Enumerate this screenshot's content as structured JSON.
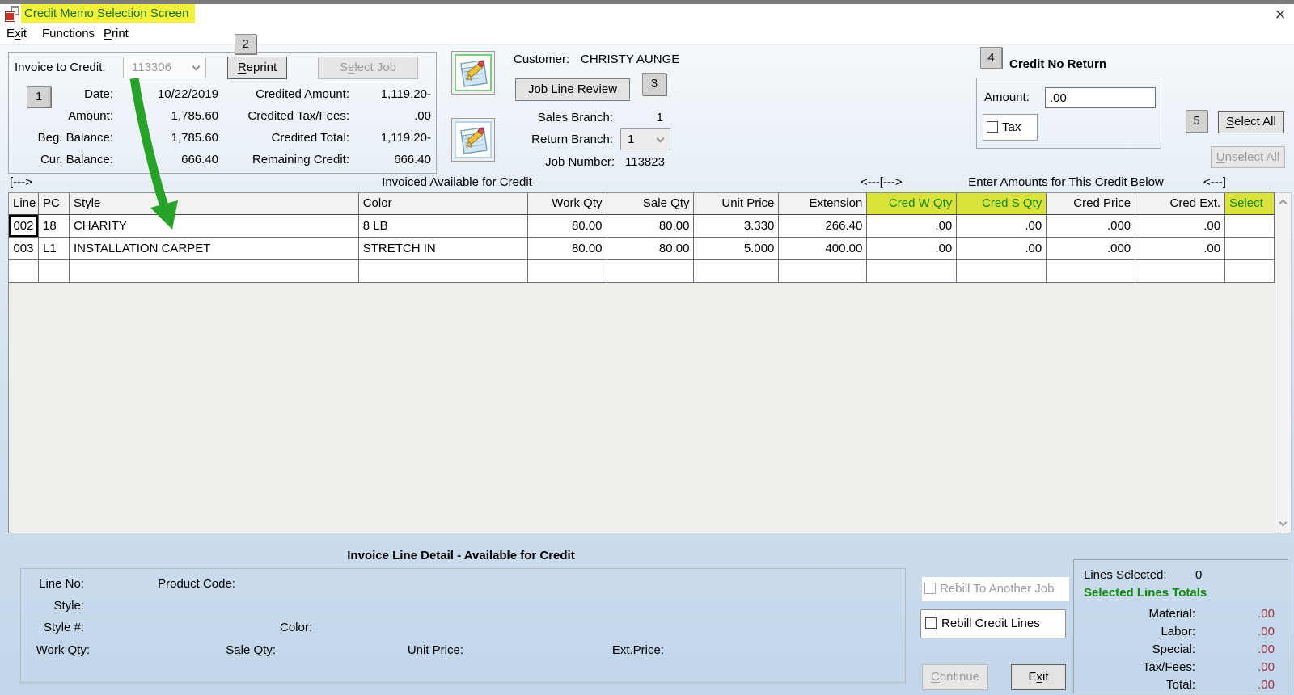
{
  "window": {
    "title": "Credit Memo Selection Screen",
    "close_glyph": "×"
  },
  "menu": {
    "exit": {
      "p": "E",
      "k": "x",
      "s": "it"
    },
    "functions": {
      "p": "Functions",
      "k": "",
      "s": ""
    },
    "print": {
      "p": "",
      "k": "P",
      "s": "rint"
    }
  },
  "badges": {
    "b1": "1",
    "b2": "2",
    "b3": "3",
    "b4": "4",
    "b5": "5"
  },
  "invoice_panel": {
    "invoice_to_credit_label": "Invoice to Credit:",
    "invoice_number": "113306",
    "reprint": {
      "p": "",
      "k": "R",
      "s": "eprint"
    },
    "select_job": {
      "p": "S",
      "k": "e",
      "s": "lect Job"
    },
    "left_fields": [
      {
        "label": "Date:",
        "value": "10/22/2019"
      },
      {
        "label": "Amount:",
        "value": "1,785.60"
      },
      {
        "label": "Beg. Balance:",
        "value": "1,785.60"
      },
      {
        "label": "Cur. Balance:",
        "value": "666.40"
      }
    ],
    "right_fields": [
      {
        "label": "Credited Amount:",
        "value": "1,119.20-"
      },
      {
        "label": "Credited Tax/Fees:",
        "value": ".00"
      },
      {
        "label": "Credited Total:",
        "value": "1,119.20-"
      },
      {
        "label": "Remaining Credit:",
        "value": "666.40"
      }
    ]
  },
  "customer_panel": {
    "customer_label": "Customer:",
    "customer_name": "CHRISTY AUNGE",
    "job_line_review": {
      "p": "",
      "k": "J",
      "s": "ob Line Review"
    },
    "sales_branch_label": "Sales Branch:",
    "sales_branch_value": "1",
    "return_branch_label": "Return Branch:",
    "return_branch_value": "1",
    "job_number_label": "Job Number:",
    "job_number_value": "113823"
  },
  "credit_no_return": {
    "title": "Credit No Return",
    "amount_label": "Amount:",
    "amount_value": ".00",
    "tax_label": "Tax",
    "select_all": {
      "p": "",
      "k": "S",
      "s": "elect All"
    },
    "unselect_all": {
      "p": "",
      "k": "U",
      "s": "nselect All"
    }
  },
  "band": {
    "left_bracket": "[--->",
    "left_title": "Invoiced Available for Credit",
    "mid_bracket": "<---[--->",
    "right_title": "Enter Amounts for This Credit Below",
    "right_bracket": "<---]"
  },
  "table": {
    "columns": [
      {
        "label": "Line",
        "hl": false
      },
      {
        "label": "PC",
        "hl": false
      },
      {
        "label": "Style",
        "hl": false
      },
      {
        "label": "Color",
        "hl": false
      },
      {
        "label": "Work Qty",
        "hl": false
      },
      {
        "label": "Sale Qty",
        "hl": false
      },
      {
        "label": "Unit Price",
        "hl": false
      },
      {
        "label": "Extension",
        "hl": false
      },
      {
        "label": "Cred W Qty",
        "hl": true
      },
      {
        "label": "Cred S Qty",
        "hl": true
      },
      {
        "label": "Cred Price",
        "hl": false
      },
      {
        "label": "Cred Ext.",
        "hl": false
      },
      {
        "label": "Select",
        "hl": true
      }
    ],
    "rows": [
      [
        "002",
        "18",
        "CHARITY",
        "8 LB",
        "80.00",
        "80.00",
        "3.330",
        "266.40",
        ".00",
        ".00",
        ".000",
        ".00",
        ""
      ],
      [
        "003",
        "L1",
        "INSTALLATION CARPET",
        "STRETCH IN",
        "80.00",
        "80.00",
        "5.000",
        "400.00",
        ".00",
        ".00",
        ".000",
        ".00",
        ""
      ],
      [
        "",
        "",
        "",
        "",
        "",
        "",
        "",
        "",
        "",
        "",
        "",
        "",
        ""
      ]
    ]
  },
  "detail_panel": {
    "title": "Invoice Line Detail - Available for Credit",
    "labels": {
      "line_no": "Line No:",
      "product_code": "Product Code:",
      "style": "Style:",
      "style_no": "Style #:",
      "color": "Color:",
      "work_qty": "Work Qty:",
      "sale_qty": "Sale Qty:",
      "unit_price": "Unit Price:",
      "ext_price": "Ext.Price:"
    }
  },
  "rebill": {
    "to_another_job": "Rebill To Another Job",
    "credit_lines": "Rebill Credit Lines"
  },
  "actions": {
    "continue_btn": {
      "p": "",
      "k": "C",
      "s": "ontinue"
    },
    "exit_btn": {
      "p": "E",
      "k": "x",
      "s": "it"
    }
  },
  "totals": {
    "lines_selected_label": "Lines Selected:",
    "lines_selected_value": "0",
    "title": "Selected Lines Totals",
    "rows": [
      {
        "label": "Material:",
        "value": ".00"
      },
      {
        "label": "Labor:",
        "value": ".00"
      },
      {
        "label": "Special:",
        "value": ".00"
      },
      {
        "label": "Tax/Fees:",
        "value": ".00"
      },
      {
        "label": "Total:",
        "value": ".00"
      }
    ]
  },
  "colors": {
    "highlight_yellow": "#f2f13c",
    "header_highlight": "#dce23c",
    "green_text": "#148a14",
    "red_value": "#9c323c",
    "arrow_green": "#28a228"
  }
}
